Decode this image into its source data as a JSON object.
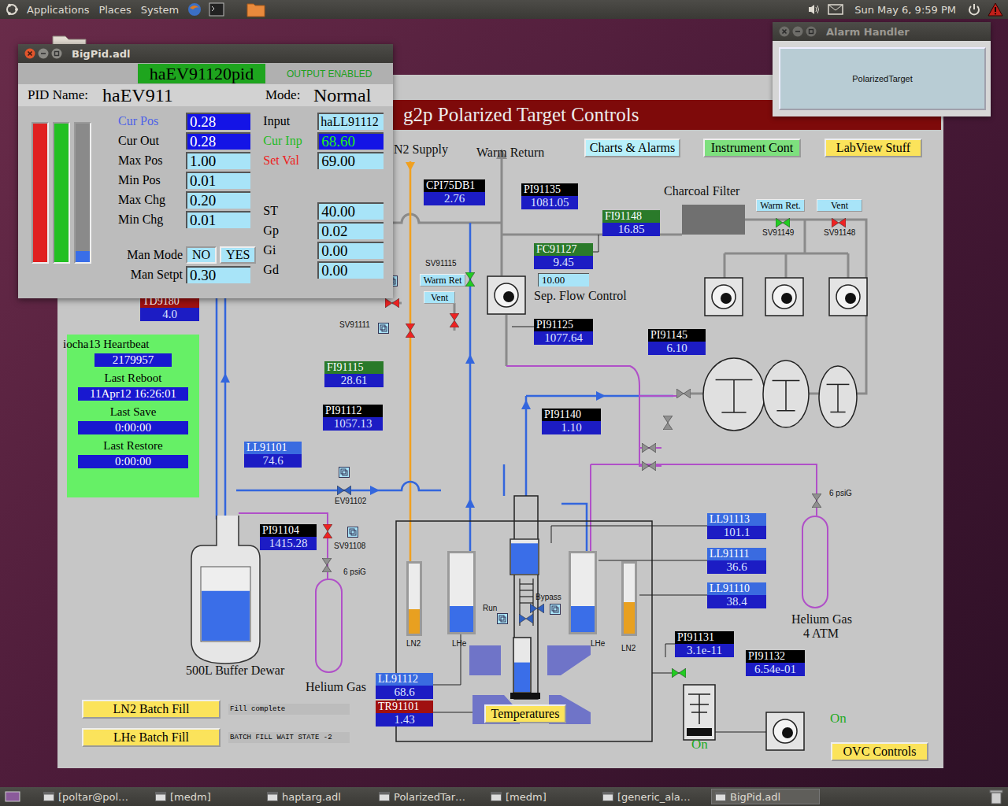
{
  "top_panel": {
    "menus": [
      "Applications",
      "Places",
      "System"
    ],
    "clock": "Sun May 6, 9:59 PM"
  },
  "taskbar": [
    {
      "label": "[poltar@pol…",
      "selected": false
    },
    {
      "label": "[medm]",
      "selected": false
    },
    {
      "label": "haptarg.adl",
      "selected": false
    },
    {
      "label": "PolarizedTar…",
      "selected": false
    },
    {
      "label": "[medm]",
      "selected": false
    },
    {
      "label": "[generic_ala…",
      "selected": false
    },
    {
      "label": "BigPid.adl",
      "selected": true
    }
  ],
  "alarm_window": {
    "title": "Alarm Handler",
    "button": "PolarizedTarget"
  },
  "pid_window": {
    "title": "BigPid.adl",
    "record": "haEV91120pid",
    "output_status": "OUTPUT ENABLED",
    "name_label": "PID Name:",
    "name": "haEV911",
    "mode_label": "Mode:",
    "mode": "Normal",
    "bars": [
      {
        "color": "#e02020",
        "level": 1
      },
      {
        "color": "#22c022",
        "level": 1
      },
      {
        "color": "#3a6ee8",
        "level": 0.08
      }
    ],
    "left_fields": [
      {
        "label": "Cur Pos",
        "value": "0.28",
        "kind": "readback",
        "color": "#4f63e6",
        "value_color": "#ffffff"
      },
      {
        "label": "Cur Out",
        "value": "0.28",
        "kind": "readback",
        "color": "#000000",
        "value_color": "#ffffff"
      },
      {
        "label": "Max Pos",
        "value": "1.00",
        "kind": "setpoint",
        "color": "#000000",
        "value_color": "#000000"
      },
      {
        "label": "Min Pos",
        "value": "0.01",
        "kind": "setpoint",
        "color": "#000000",
        "value_color": "#000000"
      },
      {
        "label": "Max Chg",
        "value": "0.20",
        "kind": "setpoint",
        "color": "#000000",
        "value_color": "#000000"
      },
      {
        "label": "Min Chg",
        "value": "0.01",
        "kind": "setpoint",
        "color": "#000000",
        "value_color": "#000000"
      }
    ],
    "right_fields": [
      {
        "label": "Input",
        "value": "haLL91112",
        "kind": "text",
        "color": "#000000",
        "value_color": "#000000"
      },
      {
        "label": "Cur Inp",
        "value": "68.60",
        "kind": "readback",
        "color": "#22bb22",
        "value_color": "#22ee22"
      },
      {
        "label": "Set Val",
        "value": "69.00",
        "kind": "setpoint",
        "color": "#ee2020",
        "value_color": "#000000"
      }
    ],
    "gain_fields": [
      {
        "label": "ST",
        "value": "40.00",
        "kind": "setpoint",
        "color": "#000000",
        "value_color": "#000000"
      },
      {
        "label": "Gp",
        "value": "0.02",
        "kind": "setpoint",
        "color": "#000000",
        "value_color": "#000000"
      },
      {
        "label": "Gi",
        "value": "0.00",
        "kind": "setpoint",
        "color": "#000000",
        "value_color": "#000000"
      },
      {
        "label": "Gd",
        "value": "0.00",
        "kind": "setpoint",
        "color": "#000000",
        "value_color": "#000000"
      }
    ],
    "manual_mode": {
      "label": "Man Mode",
      "options": [
        {
          "label": "NO",
          "selected": true
        },
        {
          "label": "YES",
          "selected": false
        }
      ]
    },
    "manual_setpoint": {
      "label": "Man Setpt",
      "value": "0.30"
    }
  },
  "main_window": {
    "title": "g2p Polarized Target Controls",
    "nav_buttons": [
      {
        "label": "Charts & Alarms",
        "color": "#b8f0fa"
      },
      {
        "label": "Instrument Cont",
        "color": "#7ee07e"
      },
      {
        "label": "LabView Stuff",
        "color": "#fbe35b"
      }
    ],
    "labels": [
      "N2 Supply",
      "Warm Return",
      "Charcoal Filter",
      "Sep. Flow Control"
    ],
    "flow_setpoint": "10.00",
    "readouts": [
      {
        "label": "TD9180",
        "value": "4.0",
        "color": "#a01010"
      },
      {
        "label": "CPI75DB1",
        "value": "2.76",
        "color": "#000000"
      },
      {
        "label": "PI91135",
        "value": "1081.05",
        "color": "#000000"
      },
      {
        "label": "FI91148",
        "value": "16.85",
        "color": "#2a7a2a"
      },
      {
        "label": "FC91127",
        "value": "9.45",
        "color": "#2a7a2a"
      },
      {
        "label": "PI91125",
        "value": "1077.64",
        "color": "#000000"
      },
      {
        "label": "PI91145",
        "value": "6.10",
        "color": "#000000"
      },
      {
        "label": "FI91115",
        "value": "28.61",
        "color": "#2a7a2a"
      },
      {
        "label": "PI91112",
        "value": "1057.13",
        "color": "#000000"
      },
      {
        "label": "PI91140",
        "value": "1.10",
        "color": "#000000"
      },
      {
        "label": "LL91101",
        "value": "74.6",
        "color": "#3a6be0"
      },
      {
        "label": "PI91104",
        "value": "1415.28",
        "color": "#000000"
      },
      {
        "label": "LL91113",
        "value": "101.1",
        "color": "#3a6be0"
      },
      {
        "label": "LL91111",
        "value": "36.6",
        "color": "#3a6be0"
      },
      {
        "label": "LL91110",
        "value": "38.4",
        "color": "#3a6be0"
      },
      {
        "label": "LL91112",
        "value": "68.6",
        "color": "#3a6be0"
      },
      {
        "label": "TR91101",
        "value": "1.43",
        "color": "#a01010"
      },
      {
        "label": "PI91131",
        "value": "3.1e-11",
        "color": "#000000"
      },
      {
        "label": "PI91132",
        "value": "6.54e-01",
        "color": "#000000"
      }
    ],
    "valves": [
      {
        "label": "SV91115",
        "color": "#22cc22"
      },
      {
        "color": "#ee2222"
      },
      {
        "label": "SV91111",
        "color": "#ee2222"
      },
      {
        "color": "#ee2222"
      },
      {
        "label": "SV91108",
        "color": "#ee2222"
      },
      {
        "label": "EV91102",
        "color": "#3060c0"
      },
      {
        "label": "SV91149",
        "color": "#22cc22"
      },
      {
        "label": "SV91148",
        "color": "#ee2222"
      },
      {
        "color": "#22cc22"
      },
      {
        "color": "#909090"
      },
      {
        "color": "#909090"
      },
      {
        "color": "#909090"
      },
      {
        "color": "#909090"
      },
      {
        "color": "#909090"
      },
      {
        "color": "#909090"
      },
      {
        "label": "Run",
        "color": "#3060c0"
      },
      {
        "label": "Bypass",
        "color": "#3060c0"
      }
    ],
    "vent_buttons": [
      "Warm Ret.",
      "Vent",
      "Warm Ret",
      "Vent"
    ],
    "tanks": [
      {
        "label": "LN2",
        "level": 0.35,
        "color": "#e8a020"
      },
      {
        "label": "LHe",
        "level": 0.33,
        "color": "#3a6ee8"
      },
      {
        "label": "LHe",
        "level": 0.33,
        "color": "#3a6ee8"
      },
      {
        "label": "LN2",
        "level": 0.45,
        "color": "#e8a020"
      }
    ],
    "dewar": {
      "label": "500L Buffer Dewar",
      "level": 0.68
    },
    "cryostat": {
      "cell_level": 0.9,
      "column_level": 0.55
    },
    "cylinders": [
      {
        "label": "Helium Gas",
        "pressure": "6 psiG"
      },
      {
        "label": "Helium Gas",
        "sublabel": "4 ATM",
        "pressure": "6 psiG"
      }
    ],
    "heartbeat": {
      "title": "iocha13 Heartbeat",
      "value": "2179957",
      "rows": [
        {
          "label": "Last Reboot",
          "value": "11Apr12 16:26:01"
        },
        {
          "label": "Last Save",
          "value": "0:00:00"
        },
        {
          "label": "Last Restore",
          "value": "0:00:00"
        }
      ]
    },
    "batch_fills": [
      {
        "label": "LN2 Batch Fill",
        "status": "Fill complete"
      },
      {
        "label": "LHe Batch Fill",
        "status": "BATCH FILL WAIT STATE -2"
      }
    ],
    "buttons": [
      "Temperatures",
      "OVC Controls"
    ],
    "pump_status": [
      "On",
      "On"
    ]
  }
}
